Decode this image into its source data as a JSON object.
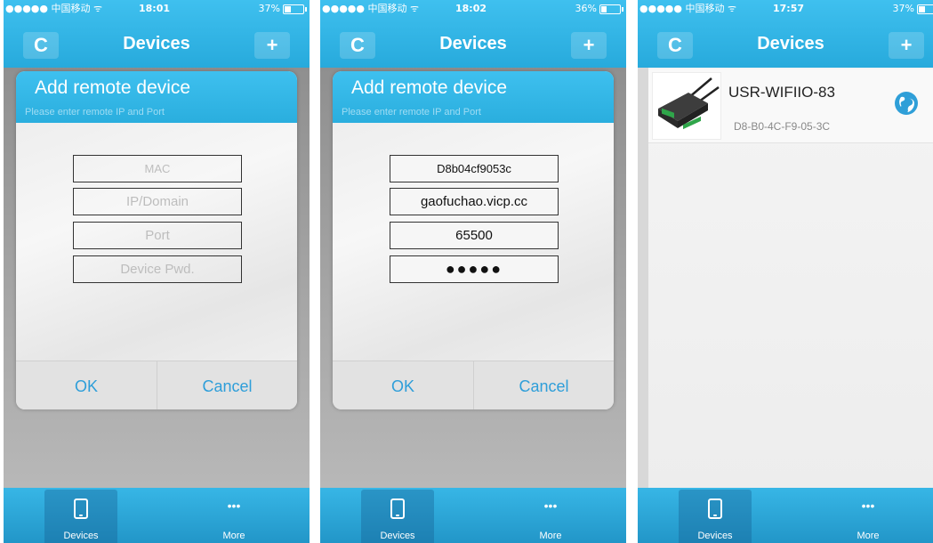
{
  "screens": [
    {
      "status": {
        "carrier": "●●●●● 中国移动 ᯤ",
        "time": "18:01",
        "battery": "37%"
      },
      "nav": {
        "title": "Devices",
        "refresh_icon": "refresh-icon",
        "add_icon": "plus-icon"
      },
      "dialog": {
        "title": "Add remote device",
        "subtitle": "Please enter remote IP and Port",
        "fields": [
          {
            "placeholder": "MAC",
            "value": ""
          },
          {
            "placeholder": "IP/Domain",
            "value": ""
          },
          {
            "placeholder": "Port",
            "value": ""
          },
          {
            "placeholder": "Device Pwd.",
            "value": ""
          }
        ],
        "ok_label": "OK",
        "cancel_label": "Cancel"
      },
      "tabs": [
        {
          "label": "Devices",
          "icon": "phone-icon",
          "active": true
        },
        {
          "label": "More",
          "icon": "more-icon",
          "active": false
        }
      ]
    },
    {
      "status": {
        "carrier": "●●●●● 中国移动 ᯤ",
        "time": "18:02",
        "battery": "36%"
      },
      "nav": {
        "title": "Devices",
        "refresh_icon": "refresh-icon",
        "add_icon": "plus-icon"
      },
      "dialog": {
        "title": "Add remote device",
        "subtitle": "Please enter remote IP and Port",
        "fields": [
          {
            "placeholder": "MAC",
            "value": "D8b04cf9053c"
          },
          {
            "placeholder": "IP/Domain",
            "value": "gaofuchao.vicp.cc"
          },
          {
            "placeholder": "Port",
            "value": "65500"
          },
          {
            "placeholder": "Device Pwd.",
            "value": "●●●●●"
          }
        ],
        "ok_label": "OK",
        "cancel_label": "Cancel"
      },
      "tabs": [
        {
          "label": "Devices",
          "icon": "phone-icon",
          "active": true
        },
        {
          "label": "More",
          "icon": "more-icon",
          "active": false
        }
      ]
    },
    {
      "status": {
        "carrier": "●●●●● 中国移动 ᯤ",
        "time": "17:57",
        "battery": "37%"
      },
      "nav": {
        "title": "Devices",
        "refresh_icon": "refresh-icon",
        "add_icon": "plus-icon"
      },
      "devices": [
        {
          "name": "USR-WIFIIO-83",
          "mac": "D8-B0-4C-F9-05-3C",
          "status_icon": "globe-icon"
        }
      ],
      "tabs": [
        {
          "label": "Devices",
          "icon": "phone-icon",
          "active": true
        },
        {
          "label": "More",
          "icon": "more-icon",
          "active": false
        }
      ]
    }
  ],
  "glyphs": {
    "refresh": "C",
    "add": "+",
    "more": "•••"
  }
}
